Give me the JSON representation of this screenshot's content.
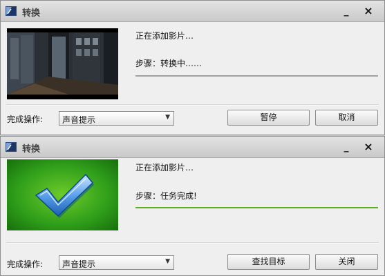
{
  "windows": [
    {
      "title": "转换",
      "minimize_glyph": "_",
      "close_glyph": "×",
      "status_line1": "正在添加影片…",
      "step_label": "步骤：转换中……",
      "progress": 0.0,
      "done_label": "完成操作:",
      "done_select_value": "声音提示",
      "button_primary": "暂停",
      "button_secondary": "取消",
      "thumbnail": "video-frame"
    },
    {
      "title": "转换",
      "minimize_glyph": "_",
      "close_glyph": "×",
      "status_line1": "正在添加影片…",
      "step_label": "步骤：任务完成!",
      "progress": 1.0,
      "done_label": "完成操作:",
      "done_select_value": "声音提示",
      "button_primary": "查找目标",
      "button_secondary": "关闭",
      "thumbnail": "checkmark"
    }
  ],
  "colors": {
    "progress_fill": "#5fae1e",
    "progress_track": "#9fa39f",
    "thumbnail_green": "#2f9e1a"
  },
  "icons": [
    "app-icon",
    "minimize-icon",
    "close-icon",
    "dropdown-arrow-icon",
    "checkmark-icon"
  ]
}
